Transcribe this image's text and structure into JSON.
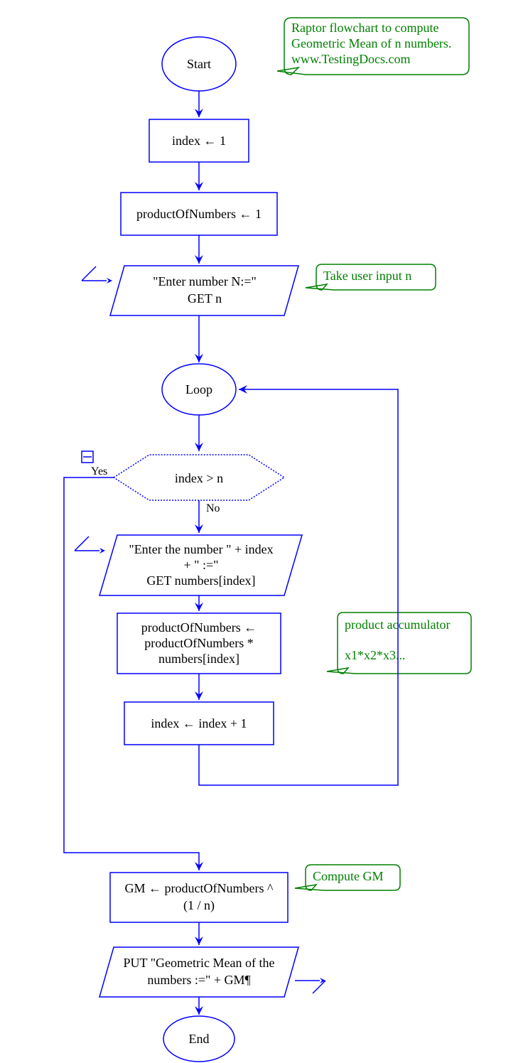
{
  "nodes": {
    "start": "Start",
    "assign1": "index ← 1",
    "assign2": "productOfNumbers ← 1",
    "input1_l1": "\"Enter number N:=\"",
    "input1_l2": "GET n",
    "loop": "Loop",
    "decision": "index > n",
    "input2_l1": "\"Enter the number \" + index",
    "input2_l2": "+ \" :=\"",
    "input2_l3": "GET numbers[index]",
    "assign3_l1": "productOfNumbers ←",
    "assign3_l2": "productOfNumbers  *",
    "assign3_l3": "numbers[index]",
    "assign4": "index ← index  +  1",
    "assign5_l1": "GM ← productOfNumbers  ^",
    "assign5_l2": "(1 / n)",
    "output_l1": "PUT \"Geometric Mean of the",
    "output_l2": "numbers :=\" + GM¶",
    "end": "End"
  },
  "labels": {
    "yes": "Yes",
    "no": "No"
  },
  "annotations": {
    "title_l1": "Raptor flowchart to compute",
    "title_l2": "Geometric Mean of n numbers.",
    "title_l3": "www.TestingDocs.com",
    "input_n": "Take user input n",
    "prod_l1": "product accumulator",
    "prod_l2": "x1*x2*x3...",
    "gm": "Compute GM"
  }
}
